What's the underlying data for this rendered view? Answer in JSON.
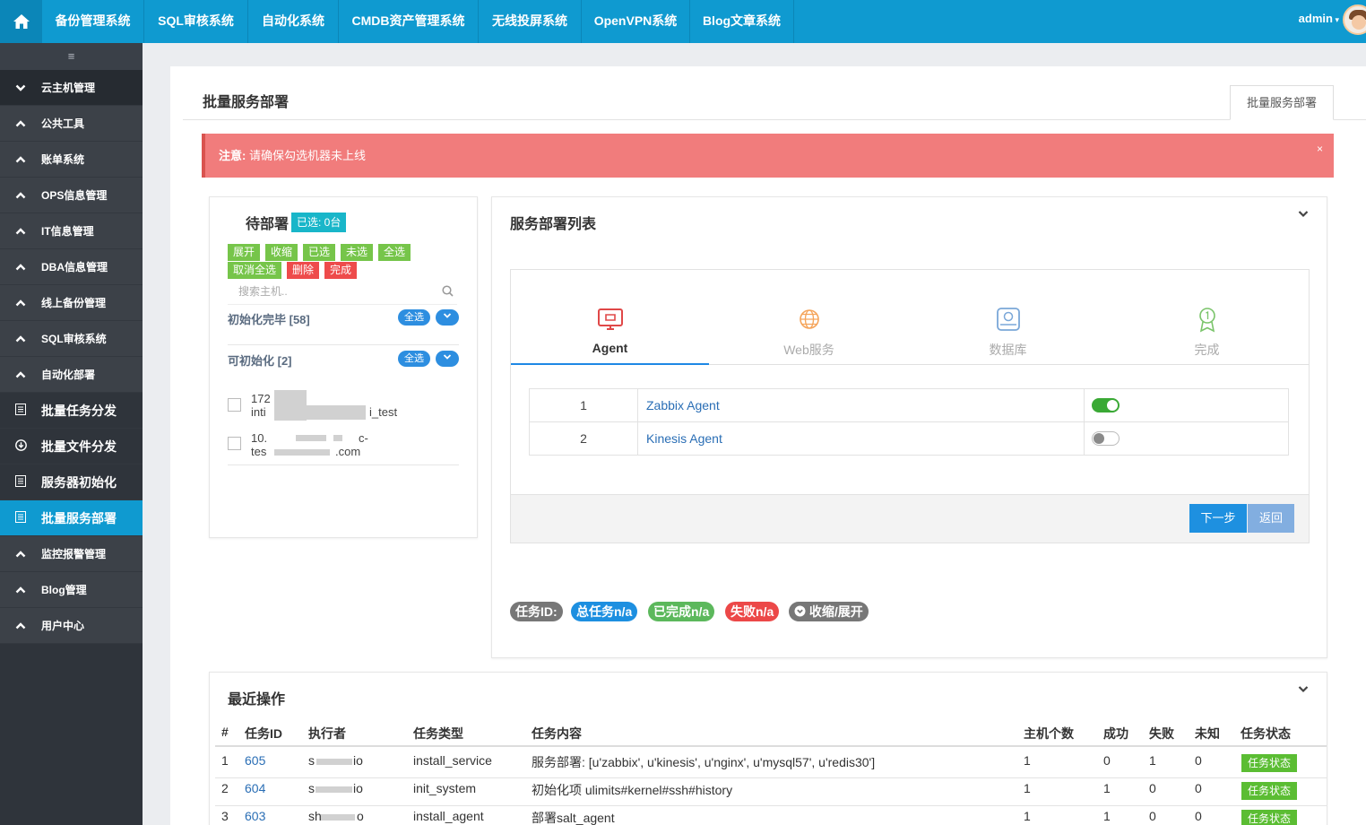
{
  "topnav": {
    "items": [
      "备份管理系统",
      "SQL审核系统",
      "自动化系统",
      "CMDB资产管理系统",
      "无线投屏系统",
      "OpenVPN系统",
      "Blog文章系统"
    ],
    "user": "admin"
  },
  "sidebar": {
    "toggle": "≡",
    "items": [
      {
        "label": "云主机管理",
        "icon": "chevron-down-icon"
      },
      {
        "label": "公共工具",
        "icon": "chevron-up-icon"
      },
      {
        "label": "账单系统",
        "icon": "chevron-up-icon"
      },
      {
        "label": "OPS信息管理",
        "icon": "chevron-up-icon"
      },
      {
        "label": "IT信息管理",
        "icon": "chevron-up-icon"
      },
      {
        "label": "DBA信息管理",
        "icon": "chevron-up-icon"
      },
      {
        "label": "线上备份管理",
        "icon": "chevron-up-icon"
      },
      {
        "label": "SQL审核系统",
        "icon": "chevron-up-icon"
      },
      {
        "label": "自动化部署",
        "icon": "chevron-up-icon"
      },
      {
        "label": "批量任务分发",
        "icon": "list-icon"
      },
      {
        "label": "批量文件分发",
        "icon": "download-icon"
      },
      {
        "label": "服务器初始化",
        "icon": "list-icon"
      },
      {
        "label": "批量服务部署",
        "icon": "list-icon"
      },
      {
        "label": "监控报警管理",
        "icon": "chevron-up-icon"
      },
      {
        "label": "Blog管理",
        "icon": "chevron-up-icon"
      },
      {
        "label": "用户中心",
        "icon": "chevron-up-icon"
      }
    ]
  },
  "page": {
    "title": "批量服务部署",
    "tab": "批量服务部署"
  },
  "alert": {
    "label": "注意:",
    "message": "请确保勾选机器未上线",
    "close": "×"
  },
  "pending": {
    "title": "待部署",
    "selected": "已选: 0台",
    "buttons": [
      "展开",
      "收缩",
      "已选",
      "未选",
      "全选",
      "取消全选",
      "删除",
      "完成"
    ],
    "search_placeholder": "搜索主机..",
    "groups": [
      {
        "label": "初始化完毕 [58]",
        "all": "全选"
      },
      {
        "label": "可初始化 [2]",
        "all": "全选"
      }
    ],
    "hosts": [
      {
        "line1": "172",
        "line2": "inti",
        "suffix": "i_test"
      },
      {
        "line1": "10.",
        "line1b": "c-",
        "line2": "tes",
        "suffix": ".com"
      }
    ]
  },
  "deploy": {
    "title": "服务部署列表",
    "steps": [
      {
        "label": "Agent",
        "icon": "monitor-icon",
        "color": "#e04848"
      },
      {
        "label": "Web服务",
        "icon": "globe-icon",
        "color": "#f5a45a"
      },
      {
        "label": "数据库",
        "icon": "database-icon",
        "color": "#7aa7d8"
      },
      {
        "label": "完成",
        "icon": "award-icon",
        "color": "#7ac46a"
      }
    ],
    "services": [
      {
        "no": "1",
        "name": "Zabbix Agent",
        "enabled": true
      },
      {
        "no": "2",
        "name": "Kinesis Agent",
        "enabled": false
      }
    ],
    "next": "下一步",
    "back": "返回",
    "task_pills": {
      "id": "任务ID:",
      "total": "总任务n/a",
      "done": "已完成n/a",
      "failed": "失败n/a",
      "toggle": "收缩/展开"
    }
  },
  "recent": {
    "title": "最近操作",
    "columns": [
      "#",
      "任务ID",
      "执行者",
      "任务类型",
      "任务内容",
      "主机个数",
      "成功",
      "失败",
      "未知",
      "任务状态"
    ],
    "rows": [
      {
        "no": "1",
        "task_id": "605",
        "executor_a": "s",
        "executor_b": "io",
        "type": "install_service",
        "content": "服务部署: [u'zabbix', u'kinesis', u'nginx', u'mysql57', u'redis30']",
        "hosts": "1",
        "success": "0",
        "fail": "1",
        "unknown": "0",
        "status": "任务状态"
      },
      {
        "no": "2",
        "task_id": "604",
        "executor_a": "s",
        "executor_b": "io",
        "type": "init_system",
        "content": "初始化项 ulimits#kernel#ssh#history",
        "hosts": "1",
        "success": "1",
        "fail": "0",
        "unknown": "0",
        "status": "任务状态"
      },
      {
        "no": "3",
        "task_id": "603",
        "executor_a": "sh",
        "executor_b": "o",
        "type": "install_agent",
        "content": "部署salt_agent",
        "hosts": "1",
        "success": "1",
        "fail": "0",
        "unknown": "0",
        "status": "任务状态"
      }
    ]
  }
}
